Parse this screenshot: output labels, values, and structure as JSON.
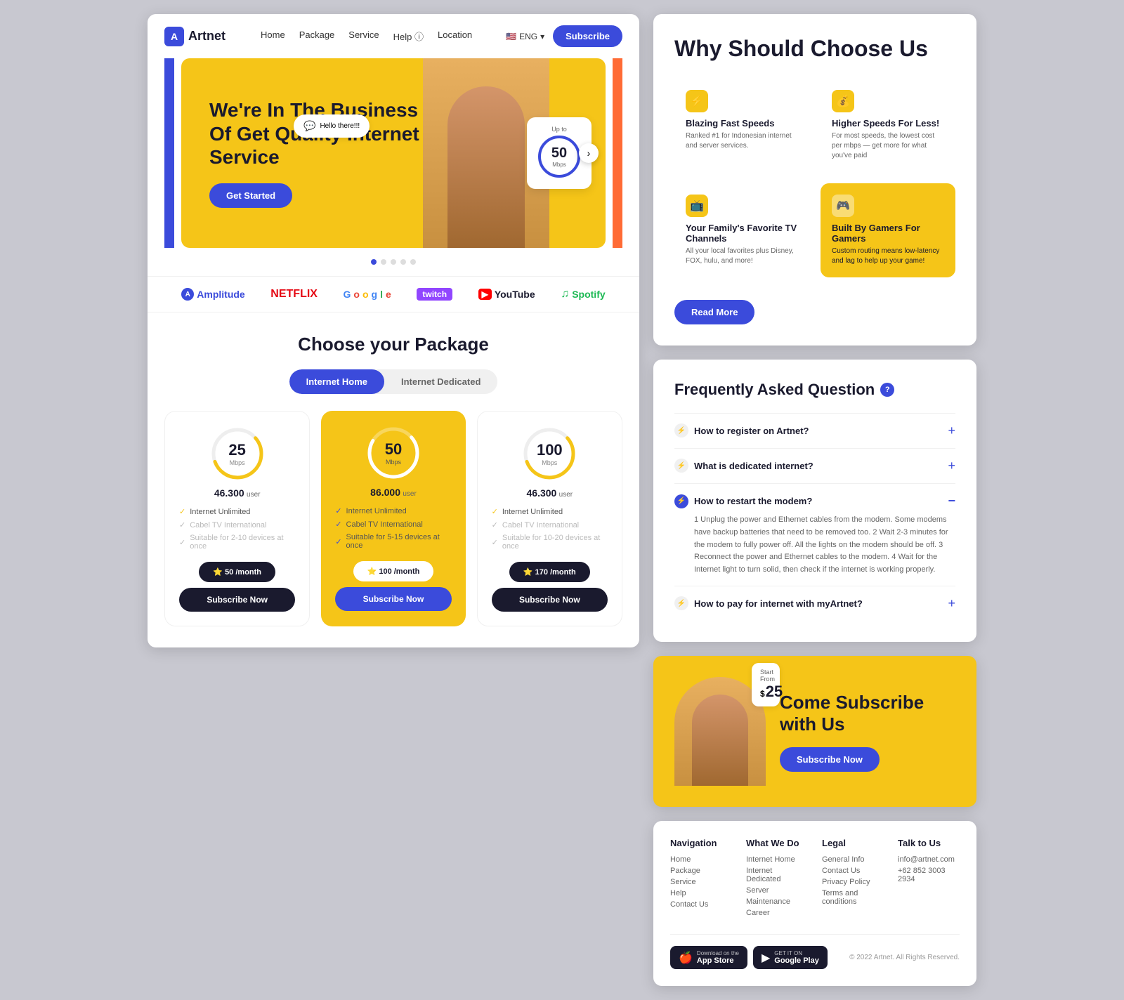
{
  "site": {
    "logo": "Artnet",
    "logo_icon": "A"
  },
  "nav": {
    "links": [
      "Home",
      "Package",
      "Service",
      "Help",
      "Location"
    ],
    "lang": "ENG",
    "subscribe_btn": "Subscribe"
  },
  "hero": {
    "title": "We're In The Business Of Get Quality Internet Service",
    "cta": "Get Started",
    "chat_text": "Hello there!!!",
    "speed_label": "Up to",
    "speed_num": "50",
    "speed_unit": "Mbps"
  },
  "brands": [
    {
      "name": "Amplitude",
      "style": "amplitude"
    },
    {
      "name": "NETFLIX",
      "style": "netflix"
    },
    {
      "name": "Google",
      "style": "google"
    },
    {
      "name": "twitch",
      "style": "twitch"
    },
    {
      "name": "YouTube",
      "style": "youtube"
    },
    {
      "name": "Spotify",
      "style": "spotify"
    }
  ],
  "packages": {
    "section_title": "Choose your Package",
    "tabs": [
      "Internet Home",
      "Internet Dedicated"
    ],
    "active_tab": 0,
    "cards": [
      {
        "speed": "25",
        "unit": "Mbps",
        "price": "46.300",
        "price_suffix": "user",
        "featured": false,
        "features": [
          "Internet Unlimited",
          "Cabel TV International",
          "Suitable for 2-10 devices at once"
        ],
        "feature_active": [
          true,
          false,
          false
        ],
        "coin_label": "⭐ 50 /month",
        "subscribe": "Subscribe Now"
      },
      {
        "speed": "50",
        "unit": "Mbps",
        "price": "86.000",
        "price_suffix": "user",
        "featured": true,
        "features": [
          "Internet Unlimited",
          "Cabel TV International",
          "Suitable for 5-15 devices at once"
        ],
        "feature_active": [
          true,
          true,
          true
        ],
        "coin_label": "⭐ 100 /month",
        "subscribe": "Subscribe Now"
      },
      {
        "speed": "100",
        "unit": "Mbps",
        "price": "46.300",
        "price_suffix": "user",
        "featured": false,
        "features": [
          "Internet Unlimited",
          "Cabel TV International",
          "Suitable for 10-20 devices at once"
        ],
        "feature_active": [
          true,
          false,
          false
        ],
        "coin_label": "⭐ 170 /month",
        "subscribe": "Subscribe Now"
      }
    ]
  },
  "why": {
    "title": "Why Should Choose Us",
    "read_more": "Read More",
    "cards": [
      {
        "icon": "⚡",
        "title": "Blazing Fast Speeds",
        "desc": "Ranked #1 for Indonesian internet and server services.",
        "highlighted": false
      },
      {
        "icon": "💰",
        "title": "Higher Speeds For Less!",
        "desc": "For most speeds, the lowest cost per mbps — get more for what you've paid",
        "highlighted": false
      },
      {
        "icon": "📺",
        "title": "Your Family's Favorite TV Channels",
        "desc": "All your local favorites plus Disney, FOX, hulu, and more!",
        "highlighted": false
      },
      {
        "icon": "🎮",
        "title": "Built By Gamers For Gamers",
        "desc": "Custom routing means low-latency and lag to help up your game!",
        "highlighted": true
      }
    ]
  },
  "faq": {
    "title": "Frequently Asked Question",
    "items": [
      {
        "q": "How to register on Artnet?",
        "open": false,
        "answer": ""
      },
      {
        "q": "What is dedicated internet?",
        "open": false,
        "answer": ""
      },
      {
        "q": "How to restart the modem?",
        "open": true,
        "answer": "1 Unplug the power and Ethernet cables from the modem. Some modems have backup batteries that need to be removed too. 2 Wait 2-3 minutes for the modem to fully power off. All the lights on the modem should be off. 3 Reconnect the power and Ethernet cables to the modem. 4 Wait for the Internet light to turn solid, then check if the internet is working properly."
      },
      {
        "q": "How to pay for internet with myArtnet?",
        "open": false,
        "answer": ""
      }
    ]
  },
  "subscribe_banner": {
    "title": "Come Subscribe with Us",
    "start_from": "Start From",
    "price": "25",
    "btn": "Subscribe Now"
  },
  "footer": {
    "cols": [
      {
        "title": "Navigation",
        "items": [
          "Home",
          "Package",
          "Service",
          "Help",
          "Contact Us"
        ]
      },
      {
        "title": "What We Do",
        "items": [
          "Internet Home",
          "Internet Dedicated",
          "Server",
          "Maintenance",
          "Career"
        ]
      },
      {
        "title": "Legal",
        "items": [
          "General Info",
          "Contact Us",
          "Privacy Policy",
          "Terms and conditions"
        ]
      },
      {
        "title": "Talk to Us",
        "items": [
          "info@artnet.com",
          "+62 852 3003 2934"
        ]
      }
    ],
    "app_store": "App Store",
    "google_play": "GET IT ON\nGoogle Play",
    "copyright": "© 2022 Artnet. All Rights Reserved."
  }
}
